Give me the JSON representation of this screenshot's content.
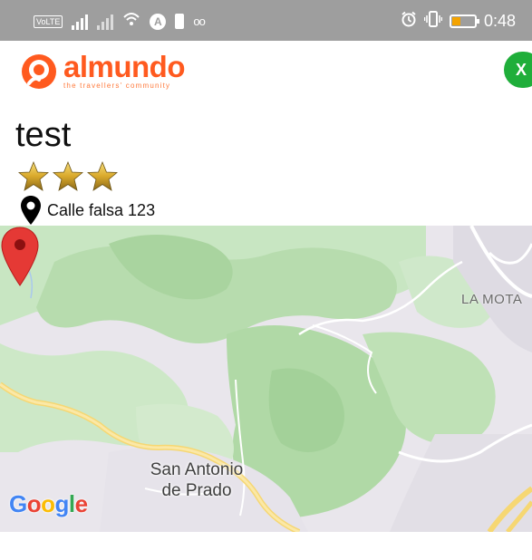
{
  "status_bar": {
    "volte_label": "VoLTE",
    "time": "0:48",
    "icons": [
      "volte-icon",
      "signal-icon",
      "signal-icon",
      "wifi-icon",
      "a-circle-icon",
      "battery-saver-icon",
      "voicemail-icon",
      "alarm-icon",
      "vibrate-icon",
      "battery-icon"
    ],
    "battery_level": 0.25,
    "battery_color": "#f4a300",
    "background_color": "#9e9e9e"
  },
  "header": {
    "brand_name": "almundo",
    "brand_tagline": "the travellers' community",
    "brand_color": "#ff5a1f",
    "close_label": "X",
    "close_color": "#1fae3a"
  },
  "hotel": {
    "name": "test",
    "stars": 3,
    "address": "Calle falsa 123"
  },
  "map": {
    "town_label_line1": "San Antonio",
    "town_label_line2": "de Prado",
    "area_label": "LA MOTA",
    "logo_parts": [
      "G",
      "o",
      "o",
      "g",
      "l",
      "e"
    ],
    "marker_color": "#e53935"
  }
}
